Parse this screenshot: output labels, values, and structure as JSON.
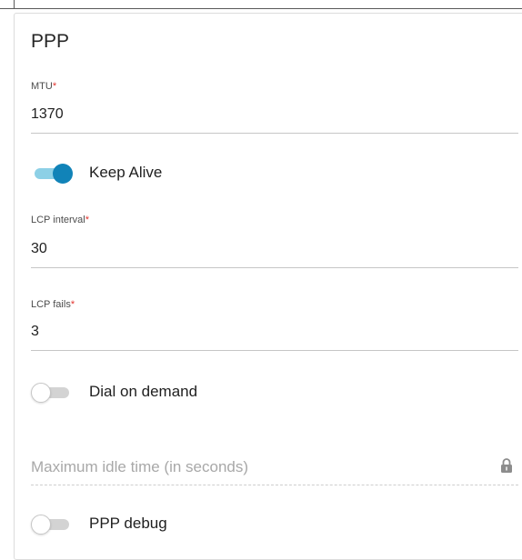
{
  "section": {
    "title": "PPP"
  },
  "mtu": {
    "label": "MTU",
    "required_mark": "*",
    "value": "1370"
  },
  "keep_alive": {
    "label": "Keep Alive",
    "enabled": true
  },
  "lcp_interval": {
    "label": "LCP interval",
    "required_mark": "*",
    "value": "30"
  },
  "lcp_fails": {
    "label": "LCP fails",
    "required_mark": "*",
    "value": "3"
  },
  "dial_on_demand": {
    "label": "Dial on demand",
    "enabled": false
  },
  "max_idle": {
    "placeholder": "Maximum idle time (in seconds)",
    "icon": "lock-icon",
    "locked": true
  },
  "ppp_debug": {
    "label": "PPP debug",
    "enabled": false
  },
  "colors": {
    "accent": "#1183b8",
    "accent_track": "#8dd0e6",
    "required": "#e3342f"
  }
}
